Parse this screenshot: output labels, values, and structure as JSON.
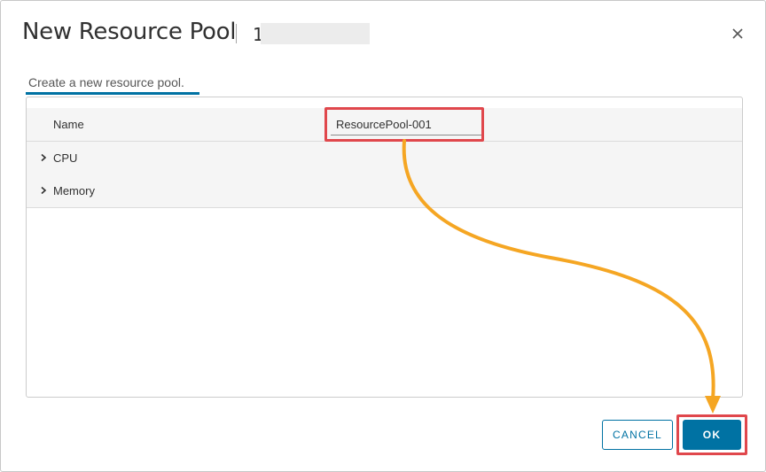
{
  "dialog": {
    "title": "New Resource Pool",
    "host_prefix": "1"
  },
  "tab": {
    "label": "Create a new resource pool."
  },
  "form": {
    "name_label": "Name",
    "name_value": "ResourcePool-001",
    "sections": [
      {
        "label": "CPU"
      },
      {
        "label": "Memory"
      }
    ]
  },
  "footer": {
    "cancel_label": "CANCEL",
    "ok_label": "OK"
  },
  "colors": {
    "accent": "#0072a3",
    "highlight": "#e0474c",
    "annotation_arrow": "#f5a623"
  },
  "icons": {
    "close": "close-icon",
    "expand": "chevron-right-icon"
  }
}
